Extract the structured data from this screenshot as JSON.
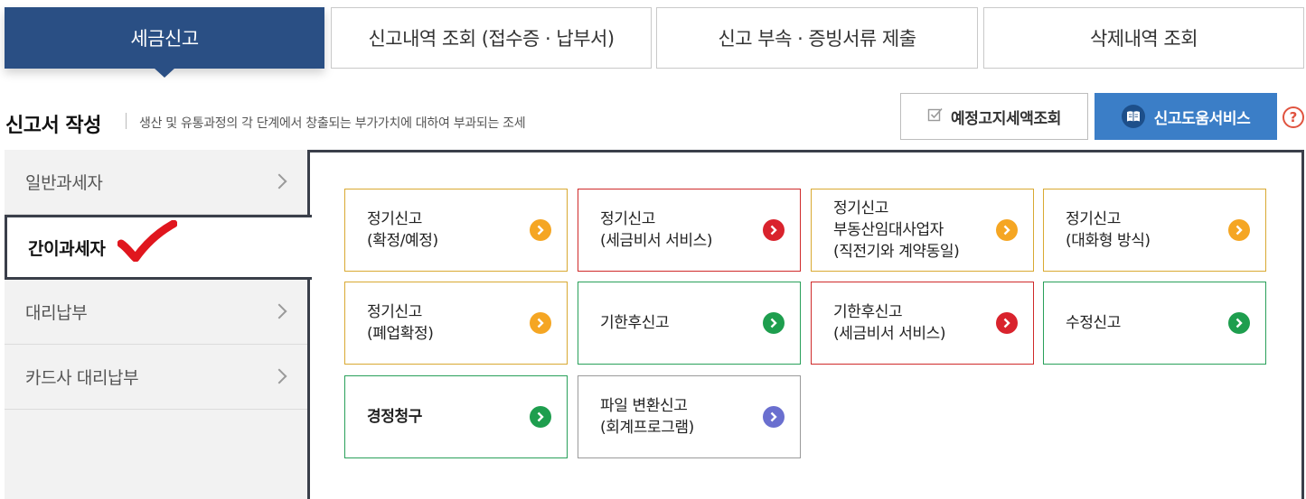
{
  "tabs": [
    {
      "label": "세금신고",
      "active": true
    },
    {
      "label": "신고내역 조회 (접수증 · 납부서)",
      "active": false
    },
    {
      "label": "신고 부속 · 증빙서류 제출",
      "active": false
    },
    {
      "label": "삭제내역 조회",
      "active": false
    }
  ],
  "section": {
    "title": "신고서 작성",
    "description": "생산 및 유통과정의 각 단계에서 창출되는 부가가치에 대하여 부과되는 조세"
  },
  "actions": {
    "preset_button": "예정고지세액조회",
    "help_service_button": "신고도움서비스",
    "help_icon": "?"
  },
  "sidebar": {
    "items": [
      {
        "label": "일반과세자",
        "active": false
      },
      {
        "label": "간이과세자",
        "active": true
      },
      {
        "label": "대리납부",
        "active": false
      },
      {
        "label": "카드사 대리납부",
        "active": false
      }
    ]
  },
  "cards": [
    {
      "line1": "정기신고",
      "line2": "(확정/예정)",
      "line3": "",
      "color": "#f5a623"
    },
    {
      "line1": "정기신고",
      "line2": "(세금비서 서비스)",
      "line3": "",
      "color": "#d9232d"
    },
    {
      "line1": "정기신고",
      "line2": "부동산임대사업자",
      "line3": "(직전기와 계약동일)",
      "color": "#f5a623"
    },
    {
      "line1": "정기신고",
      "line2": "(대화형 방식)",
      "line3": "",
      "color": "#f5a623"
    },
    {
      "line1": "정기신고",
      "line2": "(폐업확정)",
      "line3": "",
      "color": "#f5a623"
    },
    {
      "line1": "기한후신고",
      "line2": "",
      "line3": "",
      "color": "#1e9e4e"
    },
    {
      "line1": "기한후신고",
      "line2": "(세금비서 서비스)",
      "line3": "",
      "color": "#d9232d"
    },
    {
      "line1": "수정신고",
      "line2": "",
      "line3": "",
      "color": "#1e9e4e"
    },
    {
      "line1": "경정청구",
      "line2": "",
      "line3": "",
      "color": "#1e9e4e"
    },
    {
      "line1": "파일 변환신고",
      "line2": "(회계프로그램)",
      "line3": "",
      "color": "#6a6fcf"
    }
  ],
  "colors": {
    "active_tab": "#2a4f84",
    "primary_button": "#3b7ec7",
    "check_mark": "#e0161e"
  }
}
